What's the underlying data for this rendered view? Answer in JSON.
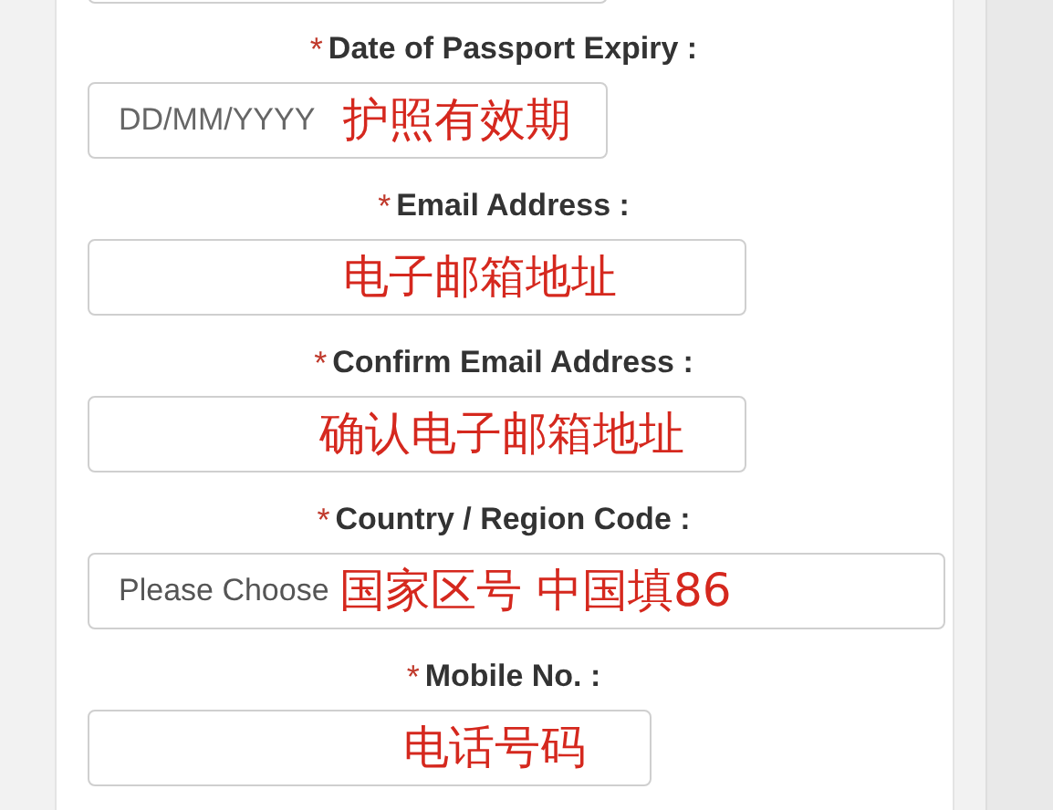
{
  "fields": [
    {
      "kind": "partial"
    },
    {
      "kind": "text",
      "required_mark": "*",
      "label": "Date of Passport Expiry :",
      "placeholder": "DD/MM/YYYY",
      "annotation": "护照有效期"
    },
    {
      "kind": "text",
      "required_mark": "*",
      "label": "Email Address :",
      "annotation": "电子邮箱地址"
    },
    {
      "kind": "text",
      "required_mark": "*",
      "label": "Confirm Email Address :",
      "annotation": "确认电子邮箱地址"
    },
    {
      "kind": "select",
      "required_mark": "*",
      "label": "Country / Region Code :",
      "value": "Please Choose",
      "annotation": "国家区号 中国填86"
    },
    {
      "kind": "text",
      "required_mark": "*",
      "label": "Mobile No. :",
      "annotation": "电话号码"
    }
  ]
}
